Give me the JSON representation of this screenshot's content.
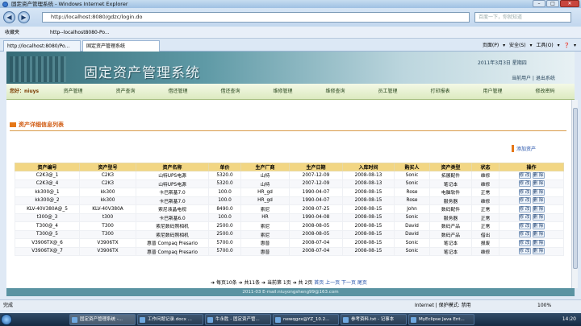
{
  "browser": {
    "window_title": "固定资产管理系统 - Windows Internet Explorer",
    "address": "http://localhost:8080/gdzc/login.do",
    "search_placeholder": "百度一下，你就知道",
    "favorites_label": "收藏夹",
    "favorite_link": "http--localhost8080-Po...",
    "tabs": [
      "http://localhost:8080/Po...",
      "固定资产管理系统"
    ],
    "tools": "页面(P) ▾   安全(S) ▾   工具(O) ▾   ❓ ▾"
  },
  "app": {
    "title": "固定资产管理系统",
    "date": "2011年3月3日  星期四",
    "user_links": "当前用户 | 退出系统",
    "current_user": "您好：niuys",
    "nav_items": [
      "资产管理",
      "资产查询",
      "借还管理",
      "借还查询",
      "维修管理",
      "维修查询",
      "员工管理",
      "打印报表",
      "用户管理",
      "修改密码"
    ]
  },
  "page": {
    "section_title": "资产详细信息列表",
    "add_label": "添加资产",
    "columns": [
      "资产编号",
      "资产型号",
      "资产名称",
      "单价",
      "生产厂商",
      "生产日期",
      "入库时间",
      "购买人",
      "资产类型",
      "状态",
      "操作"
    ],
    "rows": [
      [
        "C2K3@_1",
        "C2K3",
        "山特UPS电源",
        "5320.0",
        "山特",
        "2007-12-09",
        "2008-08-13",
        "Sonic",
        "拓展配件",
        "维修"
      ],
      [
        "C2K3@_4",
        "C2K3",
        "山特UPS电源",
        "5320.0",
        "山特",
        "2007-12-09",
        "2008-08-13",
        "Sonic",
        "笔记本",
        "维修"
      ],
      [
        "kk300@_1",
        "kk300",
        "卡巴斯基7.0",
        "100.0",
        "HR_gd",
        "1990-04-07",
        "2008-08-15",
        "Rose",
        "电脑软件",
        "正常"
      ],
      [
        "kk300@_2",
        "kk300",
        "卡巴斯基7.0",
        "100.0",
        "HR_gd",
        "1990-04-07",
        "2008-08-15",
        "Rose",
        "服务器",
        "维修"
      ],
      [
        "KLV-40V380A@_5",
        "KLV-40V380A",
        "索尼液晶电视",
        "8490.0",
        "索尼",
        "2008-07-25",
        "2008-08-15",
        "John",
        "数码配件",
        "正常"
      ],
      [
        "t300@_3",
        "t300",
        "卡巴斯基6.0",
        "100.0",
        "HR",
        "1990-04-08",
        "2008-08-15",
        "Sonic",
        "服务器",
        "正常"
      ],
      [
        "T300@_4",
        "T300",
        "索尼数码照相机",
        "2500.0",
        "索尼",
        "2008-08-05",
        "2008-08-15",
        "David",
        "数码产品",
        "正常"
      ],
      [
        "T300@_5",
        "T300",
        "索尼数码照相机",
        "2500.0",
        "索尼",
        "2008-08-05",
        "2008-08-15",
        "David",
        "数码产品",
        "借出"
      ],
      [
        "V3906TX@_6",
        "V3906TX",
        "惠普  Compaq Presario",
        "5700.0",
        "惠普",
        "2008-07-04",
        "2008-08-15",
        "Sonic",
        "笔记本",
        "报废"
      ],
      [
        "V3906TX@_7",
        "V3906TX",
        "惠普  Compaq Presario",
        "5700.0",
        "惠普",
        "2008-07-04",
        "2008-08-15",
        "Sonic",
        "笔记本",
        "维修"
      ]
    ],
    "edit_label": "修 改",
    "delete_label": "删 除",
    "pager": {
      "info": "➔ 每页10条 ➔ 共11条 ➔ 当前第 1页 ➔ 共 2页",
      "links": "首页  上一页  下一页  尾页"
    },
    "footer": "2011-03 E-mail:niuyongsheng99@163.com"
  },
  "status": {
    "left": "完成",
    "zone": "Internet | 保护模式: 禁用",
    "zoom": "100%"
  },
  "taskbar": {
    "items": [
      "固定资产管理系统 -...",
      "工作问题记录.docx ...",
      "牛永胜 - 固定资产管...",
      "newqgzx@YZ_10.2...",
      "参考资料.txt - 记事本",
      "MyEclipse Java Ent..."
    ],
    "clock": "14:20"
  }
}
